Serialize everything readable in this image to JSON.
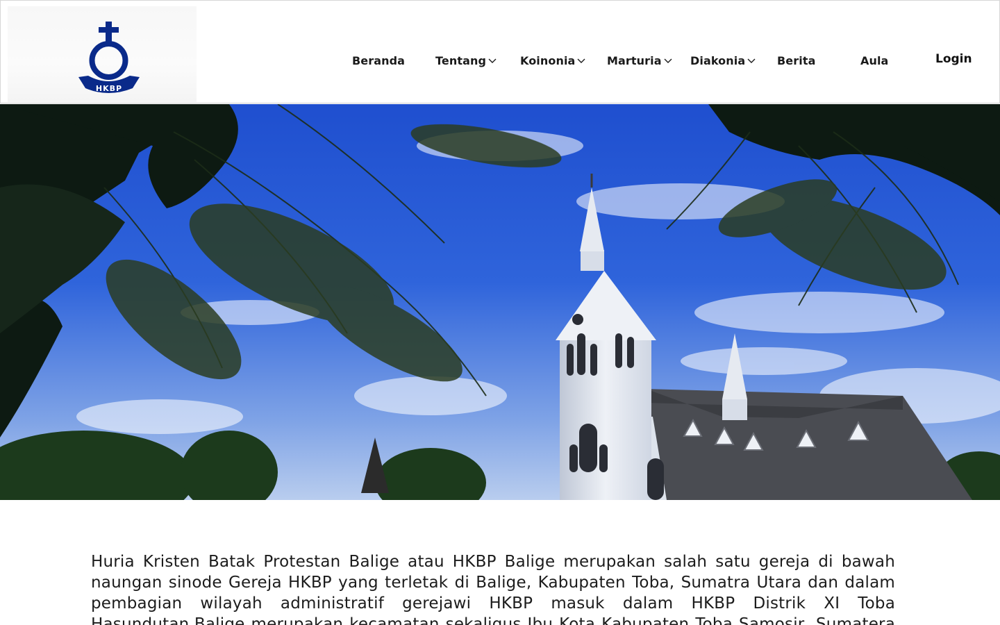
{
  "header": {
    "logo": {
      "text": "HKBP",
      "icon": "hkbp-cross-logo"
    },
    "nav": [
      {
        "label": "Beranda",
        "has_dropdown": false
      },
      {
        "label": "Tentang",
        "has_dropdown": true
      },
      {
        "label": "Koinonia",
        "has_dropdown": true
      },
      {
        "label": "Marturia",
        "has_dropdown": true
      },
      {
        "label": "Diakonia",
        "has_dropdown": true
      },
      {
        "label": "Berita",
        "has_dropdown": false
      },
      {
        "label": "Aula",
        "has_dropdown": false
      }
    ],
    "login_label": "Login"
  },
  "hero": {
    "image": "church-with-pine-trees-under-blue-sky"
  },
  "main": {
    "description": "Huria Kristen Batak Protestan Balige atau HKBP Balige merupakan salah satu gereja di bawah naungan sinode Gereja HKBP yang terletak di Balige, Kabupaten Toba, Sumatra Utara dan dalam pembagian wilayah administratif gerejawi HKBP masuk dalam HKBP Distrik XI Toba Hasundutan.Balige merupakan kecamatan sekaligus Ibu Kota Kabupaten Toba Samosir, Sumatera Utara. Di kota inilah Gereja Huria"
  },
  "colors": {
    "brand_blue": "#0a2a8a",
    "sky_blue": "#2f63dd",
    "text": "#1c1c1c"
  }
}
